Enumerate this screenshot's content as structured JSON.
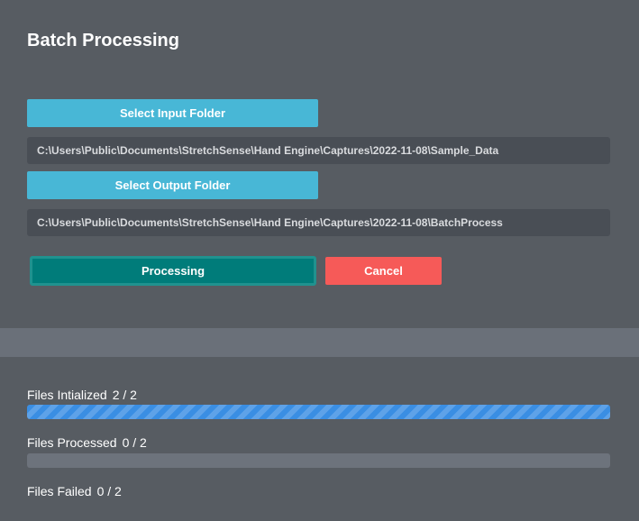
{
  "header": {
    "title": "Batch Processing"
  },
  "input": {
    "button_label": "Select Input Folder",
    "path": "C:\\Users\\Public\\Documents\\StretchSense\\Hand Engine\\Captures\\2022-11-08\\Sample_Data"
  },
  "output": {
    "button_label": "Select Output Folder",
    "path": "C:\\Users\\Public\\Documents\\StretchSense\\Hand Engine\\Captures\\2022-11-08\\BatchProcess"
  },
  "actions": {
    "processing_label": "Processing",
    "cancel_label": "Cancel"
  },
  "status": {
    "initialized": {
      "label": "Files Intialized",
      "count": "2 / 2",
      "progress": 1.0
    },
    "processed": {
      "label": "Files Processed",
      "count": "0 / 2",
      "progress": 0.0
    },
    "failed": {
      "label": "Files Failed",
      "count": "0 / 2"
    }
  },
  "colors": {
    "background": "#575c62",
    "accent_blue": "#48b7d6",
    "processing_teal": "#007c7a",
    "cancel_red": "#f65a58",
    "progress_blue": "#3a8ee3"
  }
}
